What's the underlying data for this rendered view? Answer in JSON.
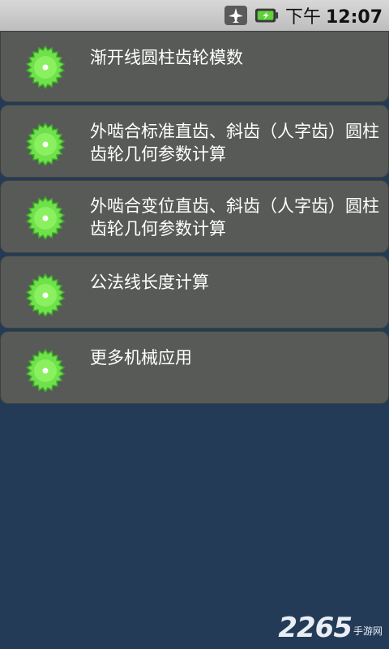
{
  "status_bar": {
    "ampm": "下午",
    "time": "12:07",
    "icons": [
      "airplane-mode-icon",
      "battery-charging-icon"
    ]
  },
  "menu": {
    "items": [
      {
        "label": "渐开线圆柱齿轮模数",
        "icon": "gear-icon"
      },
      {
        "label": "外啮合标准直齿、斜齿（人字齿）圆柱齿轮几何参数计算",
        "icon": "gear-icon"
      },
      {
        "label": "外啮合变位直齿、斜齿（人字齿）圆柱齿轮几何参数计算",
        "icon": "gear-icon"
      },
      {
        "label": "公法线长度计算",
        "icon": "gear-icon"
      },
      {
        "label": "更多机械应用",
        "icon": "gear-icon"
      }
    ]
  },
  "watermark": {
    "number": "2265",
    "suffix": "手游网"
  },
  "colors": {
    "background": "#233b57",
    "item": "#575a57",
    "gear": "#6fe14a"
  }
}
